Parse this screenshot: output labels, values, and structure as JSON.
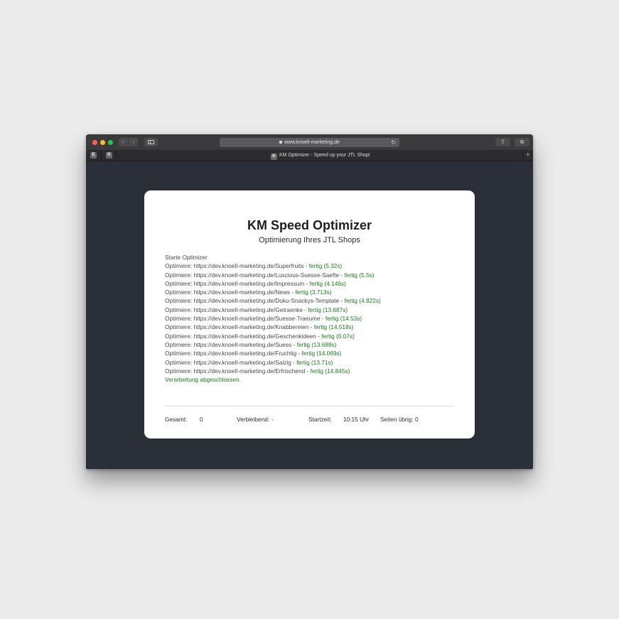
{
  "browser": {
    "url": "www.knoell-marketing.de",
    "tab_title": "KM Optimizer - Speed up your JTL Shop!",
    "pinned_tabs": [
      {
        "letter": "E"
      },
      {
        "letter": "K"
      }
    ],
    "tab_favicon_letter": "K",
    "icons": {
      "back": "chevron-left-icon",
      "forward": "chevron-right-icon",
      "sidebar": "sidebar-icon",
      "lock": "lock-icon",
      "reload": "reload-icon",
      "share": "share-icon",
      "tabs": "tabs-overview-icon",
      "new_tab": "plus-icon"
    }
  },
  "page": {
    "title": "KM Speed Optimizer",
    "subtitle": "Optimierung Ihres JTL Shops",
    "log_start": "Starte Optimizer",
    "log": [
      {
        "text": "Optimiere: https://dev.knoell-marketing.de/Superfruits - ",
        "status": "fertig (5.32s)"
      },
      {
        "text": "Optimiere: https://dev.knoell-marketing.de/Luscious-Suesse-Saefte - ",
        "status": "fertig (5.5s)"
      },
      {
        "text": "Optimiere: https://dev.knoell-marketing.de/Impressum - ",
        "status": "fertig (4.146s)"
      },
      {
        "text": "Optimiere: https://dev.knoell-marketing.de/News - ",
        "status": "fertig (3.713s)"
      },
      {
        "text": "Optimiere: https://dev.knoell-marketing.de/Doku-Snackys-Template - ",
        "status": "fertig (4.822s)"
      },
      {
        "text": "Optimiere: https://dev.knoell-marketing.de/Getraenke - ",
        "status": "fertig (13.687s)"
      },
      {
        "text": "Optimiere: https://dev.knoell-marketing.de/Suesse-Traeume - ",
        "status": "fertig (14.53s)"
      },
      {
        "text": "Optimiere: https://dev.knoell-marketing.de/Knabbereien - ",
        "status": "fertig (14.518s)"
      },
      {
        "text": "Optimiere: https://dev.knoell-marketing.de/Geschenkideen - ",
        "status": "fertig (0.07s)"
      },
      {
        "text": "Optimiere: https://dev.knoell-marketing.de/Suess - ",
        "status": "fertig (13.688s)"
      },
      {
        "text": "Optimiere: https://dev.knoell-marketing.de/Fruchtig - ",
        "status": "fertig (14.069s)"
      },
      {
        "text": "Optimiere: https://dev.knoell-marketing.de/Salzig - ",
        "status": "fertig (13.71s)"
      },
      {
        "text": "Optimiere: https://dev.knoell-marketing.de/Erfrischend - ",
        "status": "fertig (14.845s)"
      }
    ],
    "log_end": "Verarbeitung abgeschlossen.",
    "stats": {
      "total_label": "Gesamt:",
      "total_value": "0",
      "remaining_label": "Verbleibend:",
      "remaining_value": "-",
      "start_label": "Startzeit:",
      "start_value": "10:15 Uhr",
      "pages_left_label": "Seiten übrig:",
      "pages_left_value": "0"
    }
  },
  "colors": {
    "page_background": "#ebebeb",
    "browser_content_bg": "#2b3038",
    "card_bg": "#ffffff",
    "success_green": "#1a7a1a",
    "traffic_red": "#fe5f57",
    "traffic_yellow": "#febc2e",
    "traffic_green": "#28c840"
  }
}
